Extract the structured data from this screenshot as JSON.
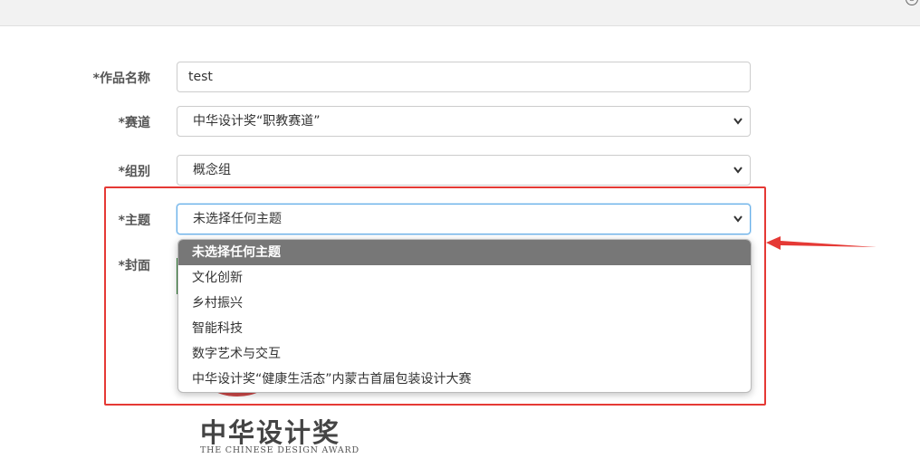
{
  "window": {
    "close_glyph": "⊗"
  },
  "form": {
    "work_name": {
      "label": "*作品名称",
      "value": "test"
    },
    "track": {
      "label": "*赛道",
      "value": "中华设计奖“职教赛道”"
    },
    "group": {
      "label": "*组别",
      "value": "概念组"
    },
    "theme": {
      "label": "*主题",
      "value": "未选择任何主题",
      "options": [
        "未选择任何主题",
        "文化创新",
        "乡村振兴",
        "智能科技",
        "数字艺术与交互",
        "中华设计奖“健康生活态”内蒙古首届包装设计大赛"
      ]
    },
    "cover": {
      "label": "*封面"
    }
  },
  "logo": {
    "cn": "中华设计奖",
    "en": "THE CHINESE DESIGN AWARD"
  },
  "colors": {
    "highlight": "#e53935",
    "selected_option_bg": "#777777",
    "focus_border": "#66afe9"
  }
}
